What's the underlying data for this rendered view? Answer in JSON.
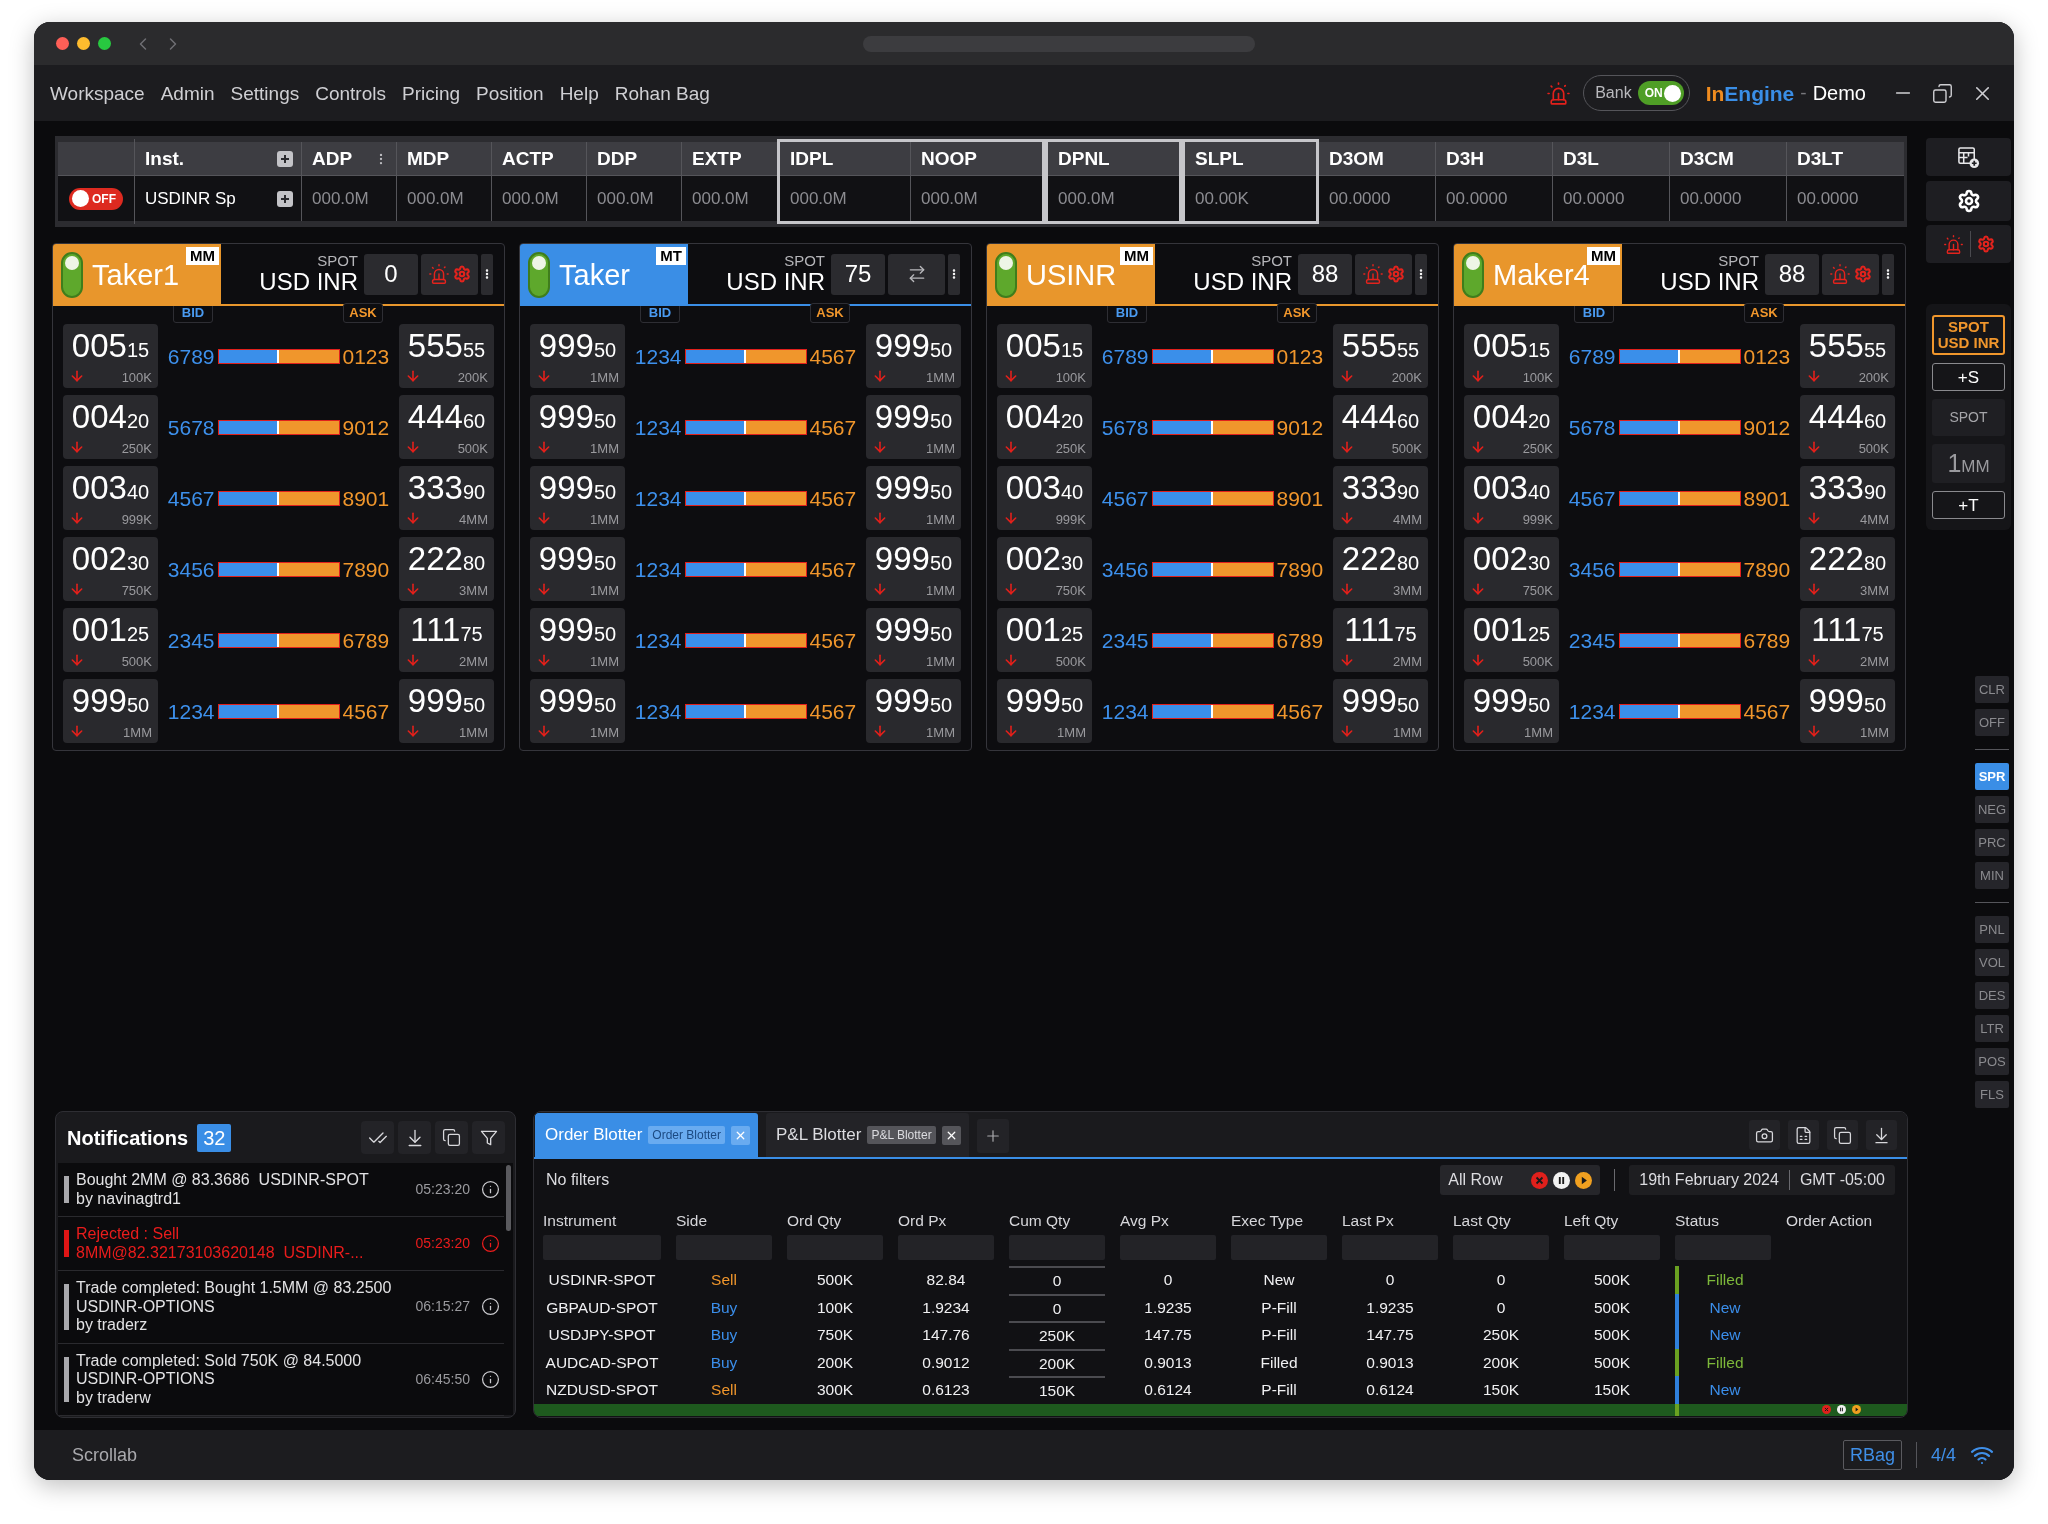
{
  "menu": [
    "Workspace",
    "Admin",
    "Settings",
    "Controls",
    "Pricing",
    "Position",
    "Help",
    "Rohan Bag"
  ],
  "header": {
    "bank_toggle": {
      "label": "Bank",
      "state_label": "ON",
      "on": true
    },
    "brand": {
      "prefix": "In",
      "name": "Engine",
      "separator": "-",
      "edition": "Demo"
    }
  },
  "summary_table": {
    "switch": {
      "label": "OFF",
      "on": false
    },
    "groups": [
      {
        "kind": "core",
        "columns": [
          {
            "label": "Inst.",
            "value": "USDINR Sp",
            "kind": "instrument"
          },
          {
            "label": "ADP",
            "value": "000.0M",
            "kind": "menu"
          },
          {
            "label": "MDP",
            "value": "000.0M",
            "kind": "plain"
          },
          {
            "label": "ACTP",
            "value": "000.0M",
            "kind": "plain"
          },
          {
            "label": "DDP",
            "value": "000.0M",
            "kind": "plain"
          },
          {
            "label": "EXTP",
            "value": "000.0M",
            "kind": "plain"
          }
        ]
      },
      {
        "kind": "framed",
        "columns": [
          {
            "label": "IDPL",
            "value": "000.0M",
            "kind": "plain"
          },
          {
            "label": "NOOP",
            "value": "000.0M",
            "kind": "plain"
          }
        ]
      },
      {
        "kind": "framed",
        "columns": [
          {
            "label": "DPNL",
            "value": "000.0M",
            "kind": "plain"
          }
        ]
      },
      {
        "kind": "framed",
        "columns": [
          {
            "label": "SLPL",
            "value": "00.00K",
            "kind": "plain"
          }
        ]
      },
      {
        "kind": "depth",
        "columns": [
          {
            "label": "D3OM",
            "value": "00.0000",
            "kind": "plain"
          },
          {
            "label": "D3H",
            "value": "00.0000",
            "kind": "plain"
          },
          {
            "label": "D3L",
            "value": "00.0000",
            "kind": "plain"
          },
          {
            "label": "D3CM",
            "value": "00.0000",
            "kind": "plain"
          },
          {
            "label": "D3LT",
            "value": "00.0000",
            "kind": "plain"
          }
        ]
      }
    ]
  },
  "tiles": [
    {
      "name": "Taker1",
      "badge": "MM",
      "color": "#e8962c",
      "active": true,
      "market": "SPOT",
      "pair": "USD INR",
      "quantity": "0",
      "kind": "alerts",
      "bid_label": "BID",
      "ask_label": "ASK",
      "rows": [
        {
          "bid": {
            "price": "005",
            "pips": "15",
            "size": "100K",
            "falling": true
          },
          "bid_qty": "6789",
          "level": 0.5,
          "ask_qty": "0123",
          "ask": {
            "price": "555",
            "pips": "55",
            "size": "200K",
            "falling": true
          }
        },
        {
          "bid": {
            "price": "004",
            "pips": "20",
            "size": "250K",
            "falling": true
          },
          "bid_qty": "5678",
          "level": 0.5,
          "ask_qty": "9012",
          "ask": {
            "price": "444",
            "pips": "60",
            "size": "500K",
            "falling": true
          }
        },
        {
          "bid": {
            "price": "003",
            "pips": "40",
            "size": "999K",
            "falling": true
          },
          "bid_qty": "4567",
          "level": 0.5,
          "ask_qty": "8901",
          "ask": {
            "price": "333",
            "pips": "90",
            "size": "4MM",
            "falling": true
          }
        },
        {
          "bid": {
            "price": "002",
            "pips": "30",
            "size": "750K",
            "falling": true
          },
          "bid_qty": "3456",
          "level": 0.5,
          "ask_qty": "7890",
          "ask": {
            "price": "222",
            "pips": "80",
            "size": "3MM",
            "falling": true
          }
        },
        {
          "bid": {
            "price": "001",
            "pips": "25",
            "size": "500K",
            "falling": true
          },
          "bid_qty": "2345",
          "level": 0.5,
          "ask_qty": "6789",
          "ask": {
            "price": "111",
            "pips": "75",
            "size": "2MM",
            "falling": true
          }
        },
        {
          "bid": {
            "price": "999",
            "pips": "50",
            "size": "1MM",
            "falling": true
          },
          "bid_qty": "1234",
          "level": 0.5,
          "ask_qty": "4567",
          "ask": {
            "price": "999",
            "pips": "50",
            "size": "1MM",
            "falling": true
          }
        }
      ]
    },
    {
      "name": "Taker",
      "badge": "MT",
      "color": "#3a8ee6",
      "active": true,
      "market": "SPOT",
      "pair": "USD INR",
      "quantity": "75",
      "kind": "convert",
      "bid_label": "BID",
      "ask_label": "ASK",
      "rows": [
        {
          "bid": {
            "price": "999",
            "pips": "50",
            "size": "1MM",
            "falling": true
          },
          "bid_qty": "1234",
          "level": 0.5,
          "ask_qty": "4567",
          "ask": {
            "price": "999",
            "pips": "50",
            "size": "1MM",
            "falling": true
          }
        },
        {
          "bid": {
            "price": "999",
            "pips": "50",
            "size": "1MM",
            "falling": true
          },
          "bid_qty": "1234",
          "level": 0.5,
          "ask_qty": "4567",
          "ask": {
            "price": "999",
            "pips": "50",
            "size": "1MM",
            "falling": true
          }
        },
        {
          "bid": {
            "price": "999",
            "pips": "50",
            "size": "1MM",
            "falling": true
          },
          "bid_qty": "1234",
          "level": 0.5,
          "ask_qty": "4567",
          "ask": {
            "price": "999",
            "pips": "50",
            "size": "1MM",
            "falling": true
          }
        },
        {
          "bid": {
            "price": "999",
            "pips": "50",
            "size": "1MM",
            "falling": true
          },
          "bid_qty": "1234",
          "level": 0.5,
          "ask_qty": "4567",
          "ask": {
            "price": "999",
            "pips": "50",
            "size": "1MM",
            "falling": true
          }
        },
        {
          "bid": {
            "price": "999",
            "pips": "50",
            "size": "1MM",
            "falling": true
          },
          "bid_qty": "1234",
          "level": 0.5,
          "ask_qty": "4567",
          "ask": {
            "price": "999",
            "pips": "50",
            "size": "1MM",
            "falling": true
          }
        },
        {
          "bid": {
            "price": "999",
            "pips": "50",
            "size": "1MM",
            "falling": true
          },
          "bid_qty": "1234",
          "level": 0.5,
          "ask_qty": "4567",
          "ask": {
            "price": "999",
            "pips": "50",
            "size": "1MM",
            "falling": true
          }
        }
      ]
    },
    {
      "name": "USINR",
      "badge": "MM",
      "color": "#e8962c",
      "active": true,
      "market": "SPOT",
      "pair": "USD INR",
      "quantity": "88",
      "kind": "alerts",
      "bid_label": "BID",
      "ask_label": "ASK",
      "rows": [
        {
          "bid": {
            "price": "005",
            "pips": "15",
            "size": "100K",
            "falling": true
          },
          "bid_qty": "6789",
          "level": 0.5,
          "ask_qty": "0123",
          "ask": {
            "price": "555",
            "pips": "55",
            "size": "200K",
            "falling": true
          }
        },
        {
          "bid": {
            "price": "004",
            "pips": "20",
            "size": "250K",
            "falling": true
          },
          "bid_qty": "5678",
          "level": 0.5,
          "ask_qty": "9012",
          "ask": {
            "price": "444",
            "pips": "60",
            "size": "500K",
            "falling": true
          }
        },
        {
          "bid": {
            "price": "003",
            "pips": "40",
            "size": "999K",
            "falling": true
          },
          "bid_qty": "4567",
          "level": 0.5,
          "ask_qty": "8901",
          "ask": {
            "price": "333",
            "pips": "90",
            "size": "4MM",
            "falling": true
          }
        },
        {
          "bid": {
            "price": "002",
            "pips": "30",
            "size": "750K",
            "falling": true
          },
          "bid_qty": "3456",
          "level": 0.5,
          "ask_qty": "7890",
          "ask": {
            "price": "222",
            "pips": "80",
            "size": "3MM",
            "falling": true
          }
        },
        {
          "bid": {
            "price": "001",
            "pips": "25",
            "size": "500K",
            "falling": true
          },
          "bid_qty": "2345",
          "level": 0.5,
          "ask_qty": "6789",
          "ask": {
            "price": "111",
            "pips": "75",
            "size": "2MM",
            "falling": true
          }
        },
        {
          "bid": {
            "price": "999",
            "pips": "50",
            "size": "1MM",
            "falling": true
          },
          "bid_qty": "1234",
          "level": 0.5,
          "ask_qty": "4567",
          "ask": {
            "price": "999",
            "pips": "50",
            "size": "1MM",
            "falling": true
          }
        }
      ]
    },
    {
      "name": "Maker4",
      "badge": "MM",
      "color": "#e8962c",
      "active": true,
      "market": "SPOT",
      "pair": "USD INR",
      "quantity": "88",
      "kind": "alerts",
      "bid_label": "BID",
      "ask_label": "ASK",
      "rows": [
        {
          "bid": {
            "price": "005",
            "pips": "15",
            "size": "100K",
            "falling": true
          },
          "bid_qty": "6789",
          "level": 0.5,
          "ask_qty": "0123",
          "ask": {
            "price": "555",
            "pips": "55",
            "size": "200K",
            "falling": true
          }
        },
        {
          "bid": {
            "price": "004",
            "pips": "20",
            "size": "250K",
            "falling": true
          },
          "bid_qty": "5678",
          "level": 0.5,
          "ask_qty": "9012",
          "ask": {
            "price": "444",
            "pips": "60",
            "size": "500K",
            "falling": true
          }
        },
        {
          "bid": {
            "price": "003",
            "pips": "40",
            "size": "999K",
            "falling": true
          },
          "bid_qty": "4567",
          "level": 0.5,
          "ask_qty": "8901",
          "ask": {
            "price": "333",
            "pips": "90",
            "size": "4MM",
            "falling": true
          }
        },
        {
          "bid": {
            "price": "002",
            "pips": "30",
            "size": "750K",
            "falling": true
          },
          "bid_qty": "3456",
          "level": 0.5,
          "ask_qty": "7890",
          "ask": {
            "price": "222",
            "pips": "80",
            "size": "3MM",
            "falling": true
          }
        },
        {
          "bid": {
            "price": "001",
            "pips": "25",
            "size": "500K",
            "falling": true
          },
          "bid_qty": "2345",
          "level": 0.5,
          "ask_qty": "6789",
          "ask": {
            "price": "111",
            "pips": "75",
            "size": "2MM",
            "falling": true
          }
        },
        {
          "bid": {
            "price": "999",
            "pips": "50",
            "size": "1MM",
            "falling": true
          },
          "bid_qty": "1234",
          "level": 0.5,
          "ask_qty": "4567",
          "ask": {
            "price": "999",
            "pips": "50",
            "size": "1MM",
            "falling": true
          }
        }
      ]
    }
  ],
  "quick_panel": {
    "instrument": {
      "market": "SPOT",
      "pair": "USD INR",
      "selected": true
    },
    "add_spot": "+S",
    "market": "SPOT",
    "size": {
      "amount": "1",
      "unit": "MM"
    },
    "add_tenor": "+T"
  },
  "side_tabs": [
    {
      "tabs": [
        {
          "label": "CLR",
          "selected": false
        },
        {
          "label": "OFF",
          "selected": false
        }
      ]
    },
    {
      "tabs": [
        {
          "label": "SPR",
          "selected": true
        },
        {
          "label": "NEG",
          "selected": false
        },
        {
          "label": "PRC",
          "selected": false
        },
        {
          "label": "MIN",
          "selected": false
        }
      ]
    },
    {
      "tabs": [
        {
          "label": "PNL",
          "selected": false
        },
        {
          "label": "VOL",
          "selected": false
        },
        {
          "label": "DES",
          "selected": false
        },
        {
          "label": "LTR",
          "selected": false
        },
        {
          "label": "POS",
          "selected": false
        },
        {
          "label": "FLS",
          "selected": false
        }
      ]
    }
  ],
  "notifications": {
    "title": "Notifications",
    "count": "32",
    "items": [
      {
        "kind": "info",
        "lines": [
          "Bought 2MM @ 83.3686  USDINR-SPOT",
          "by navinagtrd1"
        ],
        "time": "05:23:20"
      },
      {
        "kind": "error",
        "lines": [
          "Rejected : Sell",
          "8MM@82.32173103620148  USDINR-..."
        ],
        "time": "05:23:20"
      },
      {
        "kind": "info",
        "lines": [
          "Trade completed: Bought 1.5MM @ 83.2500",
          "USDINR-OPTIONS",
          "by traderz"
        ],
        "time": "06:15:27"
      },
      {
        "kind": "info",
        "lines": [
          "Trade completed: Sold 750K @ 84.5000",
          "USDINR-OPTIONS",
          "by traderw"
        ],
        "time": "06:45:50"
      }
    ]
  },
  "order_blotter": {
    "tabs": [
      {
        "label": "Order Blotter",
        "tag": "Order Blotter",
        "selected": true
      },
      {
        "label": "P&L Blotter",
        "tag": "P&L Blotter",
        "selected": false
      }
    ],
    "filter_summary": "No filters",
    "row_filter": "All Row",
    "date": "19th February 2024",
    "timezone": "GMT -05:00",
    "columns": [
      {
        "label": "Instrument",
        "kind": "text",
        "filterable": true
      },
      {
        "label": "Side",
        "kind": "side",
        "filterable": true
      },
      {
        "label": "Ord Qty",
        "kind": "text",
        "filterable": true
      },
      {
        "label": "Ord Px",
        "kind": "text",
        "filterable": true
      },
      {
        "label": "Cum Qty",
        "kind": "editable",
        "filterable": true
      },
      {
        "label": "Avg Px",
        "kind": "text",
        "filterable": true
      },
      {
        "label": "Exec Type",
        "kind": "text",
        "filterable": true
      },
      {
        "label": "Last Px",
        "kind": "text",
        "filterable": true
      },
      {
        "label": "Last Qty",
        "kind": "text",
        "filterable": true
      },
      {
        "label": "Left Qty",
        "kind": "text",
        "filterable": true
      },
      {
        "label": "Status",
        "kind": "status",
        "filterable": true
      },
      {
        "label": "Order Action",
        "kind": "action",
        "filterable": false
      }
    ],
    "rows": [
      {
        "selected": false,
        "sell": true,
        "filled": true,
        "actions": false,
        "cells": [
          "USDINR-SPOT",
          "Sell",
          "500K",
          "82.84",
          "0",
          "0",
          "New",
          "0",
          "0",
          "500K",
          "Filled"
        ]
      },
      {
        "selected": false,
        "sell": false,
        "filled": false,
        "actions": false,
        "cells": [
          "GBPAUD-SPOT",
          "Buy",
          "100K",
          "1.9234",
          "0",
          "1.9235",
          "P-Fill",
          "1.9235",
          "0",
          "500K",
          "New"
        ]
      },
      {
        "selected": false,
        "sell": false,
        "filled": false,
        "actions": false,
        "cells": [
          "USDJPY-SPOT",
          "Buy",
          "750K",
          "147.76",
          "250K",
          "147.75",
          "P-Fill",
          "147.75",
          "250K",
          "500K",
          "New"
        ]
      },
      {
        "selected": false,
        "sell": false,
        "filled": true,
        "actions": false,
        "cells": [
          "AUDCAD-SPOT",
          "Buy",
          "200K",
          "0.9012",
          "200K",
          "0.9013",
          "Filled",
          "0.9013",
          "200K",
          "500K",
          "Filled"
        ]
      },
      {
        "selected": false,
        "sell": true,
        "filled": false,
        "actions": false,
        "cells": [
          "NZDUSD-SPOT",
          "Sell",
          "300K",
          "0.6123",
          "150K",
          "0.6124",
          "P-Fill",
          "0.6124",
          "150K",
          "150K",
          "New"
        ]
      },
      {
        "selected": true,
        "filled": true,
        "actions": true
      }
    ]
  },
  "status_bar": {
    "label": "Scrollab",
    "user": "RBag",
    "page": "4/4"
  }
}
